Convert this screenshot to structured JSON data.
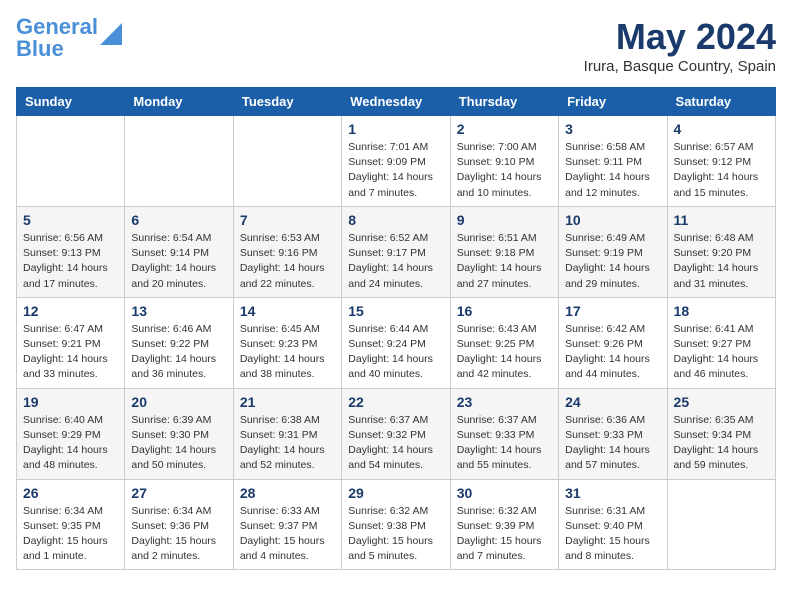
{
  "header": {
    "logo_line1": "General",
    "logo_line2": "Blue",
    "month_title": "May 2024",
    "location": "Irura, Basque Country, Spain"
  },
  "weekdays": [
    "Sunday",
    "Monday",
    "Tuesday",
    "Wednesday",
    "Thursday",
    "Friday",
    "Saturday"
  ],
  "weeks": [
    [
      {
        "day": null
      },
      {
        "day": null
      },
      {
        "day": null
      },
      {
        "day": 1,
        "sunrise": "Sunrise: 7:01 AM",
        "sunset": "Sunset: 9:09 PM",
        "daylight": "Daylight: 14 hours and 7 minutes."
      },
      {
        "day": 2,
        "sunrise": "Sunrise: 7:00 AM",
        "sunset": "Sunset: 9:10 PM",
        "daylight": "Daylight: 14 hours and 10 minutes."
      },
      {
        "day": 3,
        "sunrise": "Sunrise: 6:58 AM",
        "sunset": "Sunset: 9:11 PM",
        "daylight": "Daylight: 14 hours and 12 minutes."
      },
      {
        "day": 4,
        "sunrise": "Sunrise: 6:57 AM",
        "sunset": "Sunset: 9:12 PM",
        "daylight": "Daylight: 14 hours and 15 minutes."
      }
    ],
    [
      {
        "day": 5,
        "sunrise": "Sunrise: 6:56 AM",
        "sunset": "Sunset: 9:13 PM",
        "daylight": "Daylight: 14 hours and 17 minutes."
      },
      {
        "day": 6,
        "sunrise": "Sunrise: 6:54 AM",
        "sunset": "Sunset: 9:14 PM",
        "daylight": "Daylight: 14 hours and 20 minutes."
      },
      {
        "day": 7,
        "sunrise": "Sunrise: 6:53 AM",
        "sunset": "Sunset: 9:16 PM",
        "daylight": "Daylight: 14 hours and 22 minutes."
      },
      {
        "day": 8,
        "sunrise": "Sunrise: 6:52 AM",
        "sunset": "Sunset: 9:17 PM",
        "daylight": "Daylight: 14 hours and 24 minutes."
      },
      {
        "day": 9,
        "sunrise": "Sunrise: 6:51 AM",
        "sunset": "Sunset: 9:18 PM",
        "daylight": "Daylight: 14 hours and 27 minutes."
      },
      {
        "day": 10,
        "sunrise": "Sunrise: 6:49 AM",
        "sunset": "Sunset: 9:19 PM",
        "daylight": "Daylight: 14 hours and 29 minutes."
      },
      {
        "day": 11,
        "sunrise": "Sunrise: 6:48 AM",
        "sunset": "Sunset: 9:20 PM",
        "daylight": "Daylight: 14 hours and 31 minutes."
      }
    ],
    [
      {
        "day": 12,
        "sunrise": "Sunrise: 6:47 AM",
        "sunset": "Sunset: 9:21 PM",
        "daylight": "Daylight: 14 hours and 33 minutes."
      },
      {
        "day": 13,
        "sunrise": "Sunrise: 6:46 AM",
        "sunset": "Sunset: 9:22 PM",
        "daylight": "Daylight: 14 hours and 36 minutes."
      },
      {
        "day": 14,
        "sunrise": "Sunrise: 6:45 AM",
        "sunset": "Sunset: 9:23 PM",
        "daylight": "Daylight: 14 hours and 38 minutes."
      },
      {
        "day": 15,
        "sunrise": "Sunrise: 6:44 AM",
        "sunset": "Sunset: 9:24 PM",
        "daylight": "Daylight: 14 hours and 40 minutes."
      },
      {
        "day": 16,
        "sunrise": "Sunrise: 6:43 AM",
        "sunset": "Sunset: 9:25 PM",
        "daylight": "Daylight: 14 hours and 42 minutes."
      },
      {
        "day": 17,
        "sunrise": "Sunrise: 6:42 AM",
        "sunset": "Sunset: 9:26 PM",
        "daylight": "Daylight: 14 hours and 44 minutes."
      },
      {
        "day": 18,
        "sunrise": "Sunrise: 6:41 AM",
        "sunset": "Sunset: 9:27 PM",
        "daylight": "Daylight: 14 hours and 46 minutes."
      }
    ],
    [
      {
        "day": 19,
        "sunrise": "Sunrise: 6:40 AM",
        "sunset": "Sunset: 9:29 PM",
        "daylight": "Daylight: 14 hours and 48 minutes."
      },
      {
        "day": 20,
        "sunrise": "Sunrise: 6:39 AM",
        "sunset": "Sunset: 9:30 PM",
        "daylight": "Daylight: 14 hours and 50 minutes."
      },
      {
        "day": 21,
        "sunrise": "Sunrise: 6:38 AM",
        "sunset": "Sunset: 9:31 PM",
        "daylight": "Daylight: 14 hours and 52 minutes."
      },
      {
        "day": 22,
        "sunrise": "Sunrise: 6:37 AM",
        "sunset": "Sunset: 9:32 PM",
        "daylight": "Daylight: 14 hours and 54 minutes."
      },
      {
        "day": 23,
        "sunrise": "Sunrise: 6:37 AM",
        "sunset": "Sunset: 9:33 PM",
        "daylight": "Daylight: 14 hours and 55 minutes."
      },
      {
        "day": 24,
        "sunrise": "Sunrise: 6:36 AM",
        "sunset": "Sunset: 9:33 PM",
        "daylight": "Daylight: 14 hours and 57 minutes."
      },
      {
        "day": 25,
        "sunrise": "Sunrise: 6:35 AM",
        "sunset": "Sunset: 9:34 PM",
        "daylight": "Daylight: 14 hours and 59 minutes."
      }
    ],
    [
      {
        "day": 26,
        "sunrise": "Sunrise: 6:34 AM",
        "sunset": "Sunset: 9:35 PM",
        "daylight": "Daylight: 15 hours and 1 minute."
      },
      {
        "day": 27,
        "sunrise": "Sunrise: 6:34 AM",
        "sunset": "Sunset: 9:36 PM",
        "daylight": "Daylight: 15 hours and 2 minutes."
      },
      {
        "day": 28,
        "sunrise": "Sunrise: 6:33 AM",
        "sunset": "Sunset: 9:37 PM",
        "daylight": "Daylight: 15 hours and 4 minutes."
      },
      {
        "day": 29,
        "sunrise": "Sunrise: 6:32 AM",
        "sunset": "Sunset: 9:38 PM",
        "daylight": "Daylight: 15 hours and 5 minutes."
      },
      {
        "day": 30,
        "sunrise": "Sunrise: 6:32 AM",
        "sunset": "Sunset: 9:39 PM",
        "daylight": "Daylight: 15 hours and 7 minutes."
      },
      {
        "day": 31,
        "sunrise": "Sunrise: 6:31 AM",
        "sunset": "Sunset: 9:40 PM",
        "daylight": "Daylight: 15 hours and 8 minutes."
      },
      {
        "day": null
      }
    ]
  ]
}
